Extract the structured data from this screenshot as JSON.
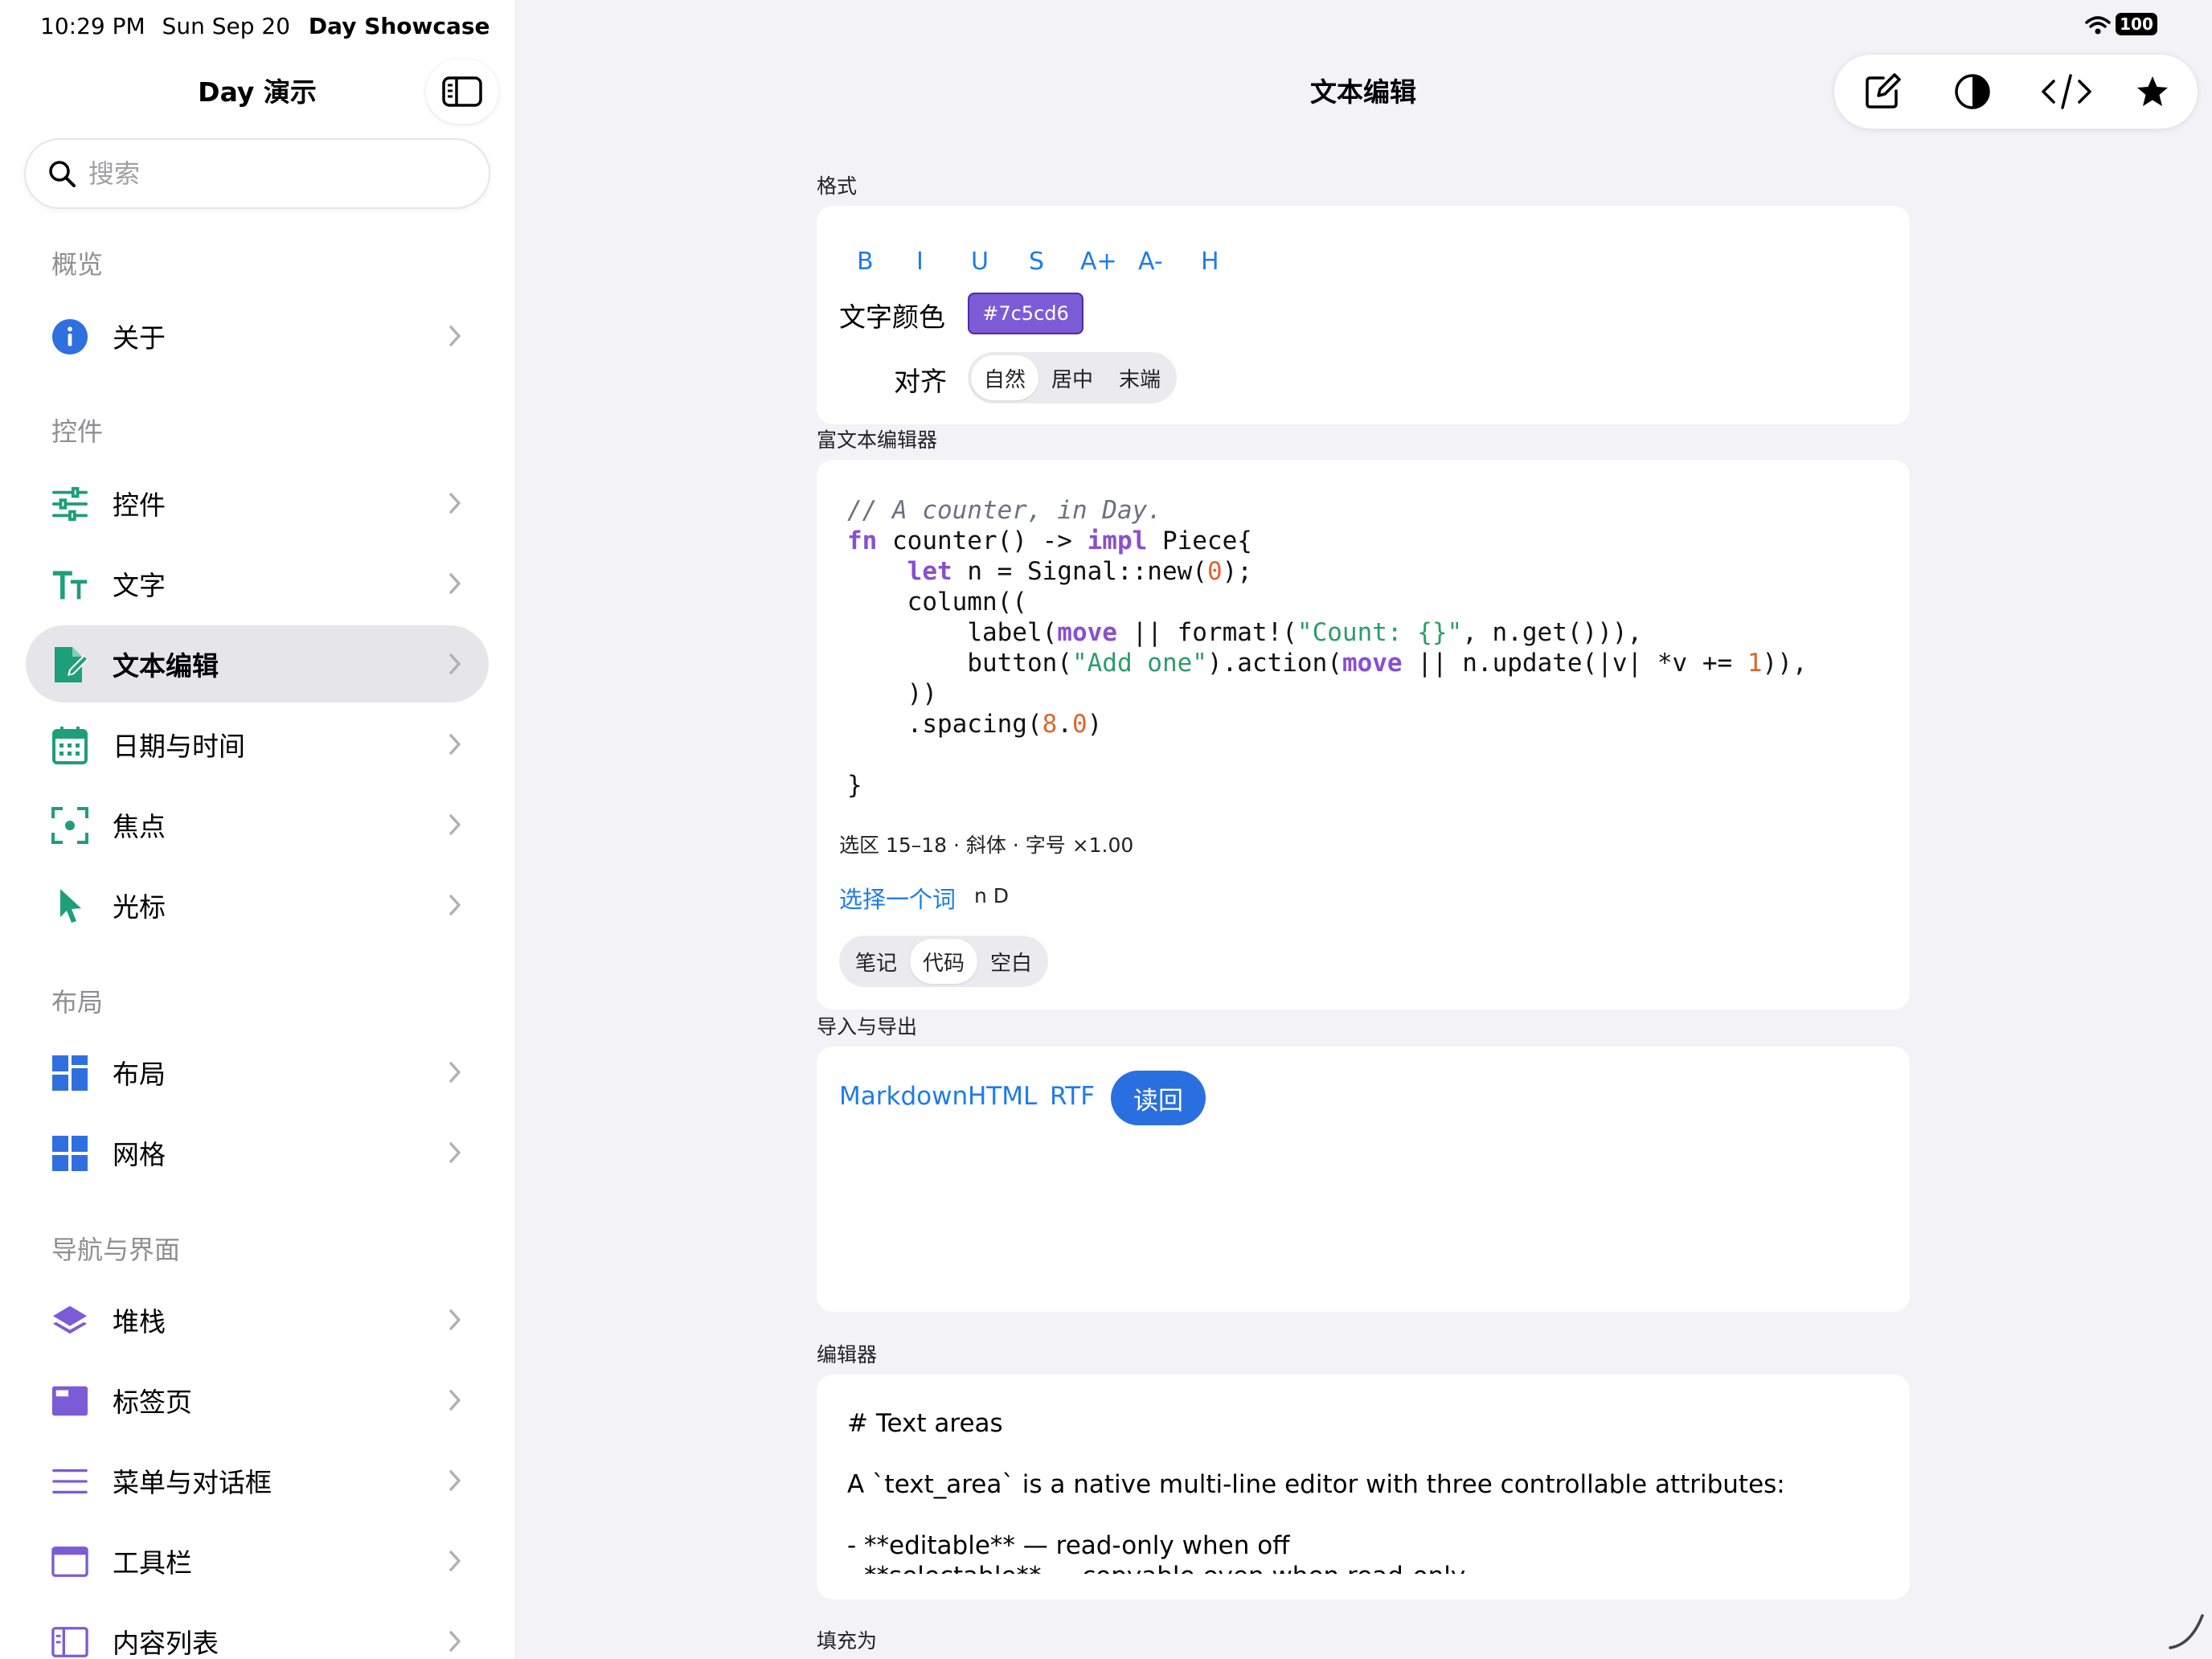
{
  "status_bar": {
    "time": "10:29 PM",
    "date": "Sun Sep 20",
    "app": "Day Showcase",
    "battery": "100"
  },
  "sidebar": {
    "title": "Day 演示",
    "search_placeholder": "搜索",
    "sections": [
      {
        "header": "概览",
        "items": [
          {
            "label": "关于",
            "icon": "info-icon"
          }
        ]
      },
      {
        "header": "控件",
        "items": [
          {
            "label": "控件",
            "icon": "sliders-icon"
          },
          {
            "label": "文字",
            "icon": "text-size-icon"
          },
          {
            "label": "文本编辑",
            "icon": "document-edit-icon",
            "active": true
          },
          {
            "label": "日期与时间",
            "icon": "calendar-icon"
          },
          {
            "label": "焦点",
            "icon": "focus-icon"
          },
          {
            "label": "光标",
            "icon": "cursor-icon"
          }
        ]
      },
      {
        "header": "布局",
        "items": [
          {
            "label": "布局",
            "icon": "layout-icon"
          },
          {
            "label": "网格",
            "icon": "grid-icon"
          }
        ]
      },
      {
        "header": "导航与界面",
        "items": [
          {
            "label": "堆栈",
            "icon": "stack-icon"
          },
          {
            "label": "标签页",
            "icon": "tabs-icon"
          },
          {
            "label": "菜单与对话框",
            "icon": "menu-icon"
          },
          {
            "label": "工具栏",
            "icon": "toolbar-icon"
          },
          {
            "label": "内容列表",
            "icon": "content-list-icon"
          }
        ]
      }
    ]
  },
  "main": {
    "title": "文本编辑",
    "toolbar": [
      "compose-icon",
      "contrast-icon",
      "code-icon",
      "star-icon"
    ],
    "format": {
      "section_label": "格式",
      "buttons": [
        "B",
        "I",
        "U",
        "S",
        "A+",
        "A-",
        "H"
      ],
      "color_label": "文字颜色",
      "color_value": "#7c5cd6",
      "align_label": "对齐",
      "align_options": [
        "自然",
        "居中",
        "末端"
      ],
      "align_selected": "自然"
    },
    "rich_editor": {
      "section_label": "富文本编辑器",
      "code": {
        "comment": "// A counter, in Day.",
        "kw_fn": "fn",
        "sig": " counter() -> ",
        "kw_impl": "impl",
        "ret": " Piece{",
        "kw_let": "let",
        "let_rest": " n = Signal::new(",
        "zero": "0",
        "let_end": ");",
        "column": "column((",
        "label_start": "label(",
        "kw_move": "move",
        "label_mid": " || format!(",
        "str_count": "\"Count: {}\"",
        "label_end": ", n.get())),",
        "button_start": "button(",
        "str_add": "\"Add one\"",
        "button_mid": ").action(",
        "button_rest": " || n.update(|v| *v += ",
        "one": "1",
        "button_end": ")),",
        "close_paren": "))",
        "spacing_start": ".spacing(",
        "spacing_8": "8",
        "spacing_dot": ".",
        "spacing_0": "0",
        "spacing_end": ")",
        "close_brace": "}"
      },
      "selection_info": "选区 15–18 · 斜体 · 字号 ×1.00",
      "select_word_link": "选择一个词",
      "selected_word": "n D",
      "modes": [
        "笔记",
        "代码",
        "空白"
      ],
      "mode_selected": "代码"
    },
    "import_export": {
      "section_label": "导入与导出",
      "links": [
        "Markdown",
        "HTML",
        "RTF"
      ],
      "readback_button": "读回"
    },
    "editor": {
      "section_label": "编辑器",
      "lines": [
        "# Text areas",
        "",
        "A `text_area` is a native multi-line editor with three controllable attributes:",
        "",
        "- **editable** — read-only when off",
        "- **selectable** — copyable even when read-only"
      ]
    },
    "fill_label": "填充为"
  },
  "colors": {
    "accent": "#1d7bf0",
    "sidebar_icon_green": "#1f9e7a",
    "sidebar_icon_blue": "#2f6fe0",
    "sidebar_icon_purple": "#7c5cd6",
    "swatch": "#7c5cd6"
  }
}
